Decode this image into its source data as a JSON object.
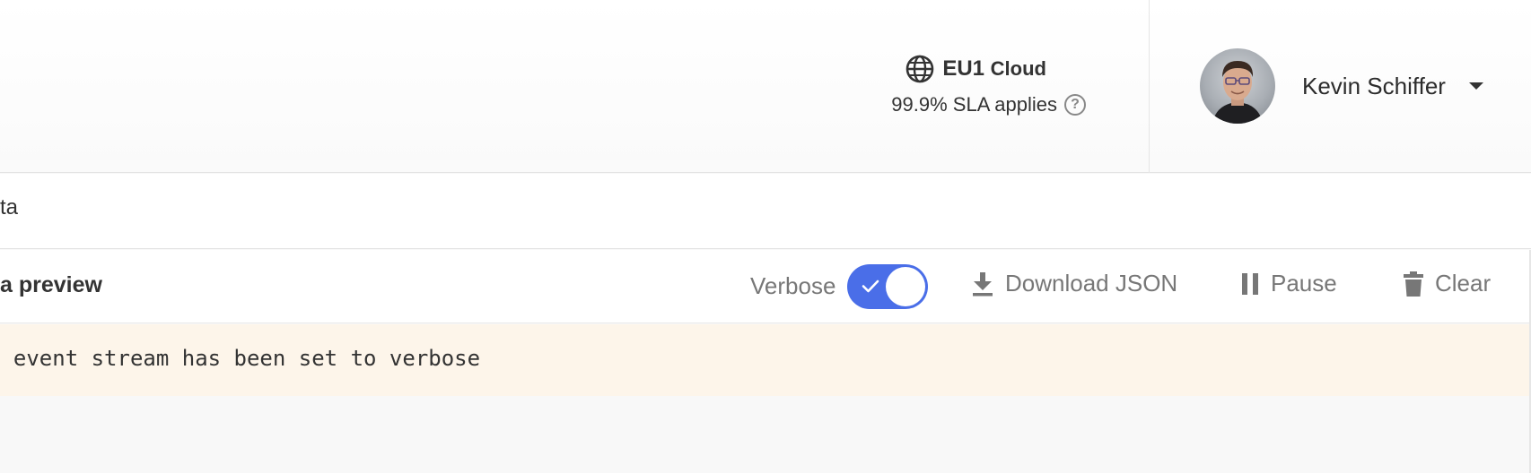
{
  "header": {
    "region": {
      "icon": "globe-icon",
      "code": "EU1",
      "name": "Cloud",
      "sla": "99.9% SLA applies",
      "help_icon": "question-circle-icon",
      "help_glyph": "?"
    },
    "user": {
      "name": "Kevin Schiffer",
      "menu_icon": "caret-down-icon"
    }
  },
  "tabs": {
    "visible_fragment": "ta"
  },
  "toolbar": {
    "title": "a preview",
    "verbose_label": "Verbose",
    "verbose_enabled": true,
    "download_label": "Download JSON",
    "pause_label": "Pause",
    "clear_label": "Clear",
    "accent_color": "#4a6ee8"
  },
  "notice": {
    "text": "- event stream has been set to verbose",
    "background": "#fdf5ea"
  }
}
